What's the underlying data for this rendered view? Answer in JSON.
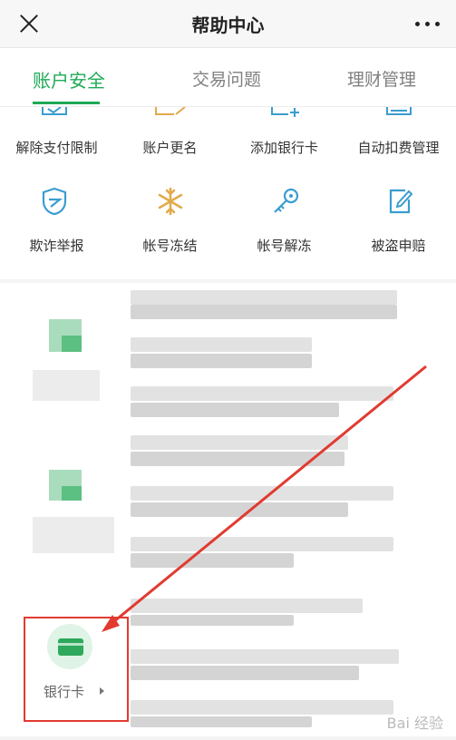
{
  "header": {
    "title": "帮助中心"
  },
  "tabs": [
    {
      "label": "账户安全",
      "active": true
    },
    {
      "label": "交易问题",
      "active": false
    },
    {
      "label": "理财管理",
      "active": false
    }
  ],
  "grid": {
    "row1": [
      "解除支付限制",
      "账户更名",
      "添加银行卡",
      "自动扣费管理"
    ],
    "row2": [
      "欺诈举报",
      "帐号冻结",
      "帐号解冻",
      "被盗申赔"
    ]
  },
  "bank_card": {
    "label": "银行卡"
  },
  "watermark": "Bai 经验",
  "colors": {
    "accent": "#1eaa56",
    "highlight": "#e23a30"
  },
  "icons": {
    "close": "close-icon",
    "more": "more-icon",
    "fraud": "shield-icon",
    "freeze": "snowflake-icon",
    "unfreeze": "key-icon",
    "claim": "edit-icon",
    "bank": "bank-card-icon"
  }
}
